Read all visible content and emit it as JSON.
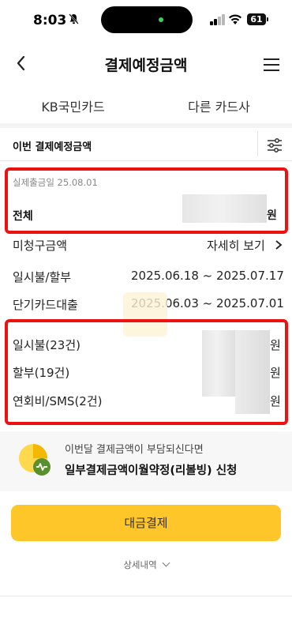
{
  "status_bar": {
    "time": "8:03",
    "battery": "61"
  },
  "header": {
    "title": "결제예정금액"
  },
  "tabs": [
    {
      "label": "KB국민카드"
    },
    {
      "label": "다른 카드사"
    }
  ],
  "section": {
    "title": "이번 결제예정금액",
    "payment_date": "실제출금일 25.08.01",
    "total_label": "전체",
    "total_unit": "원"
  },
  "details": {
    "unbilled_label": "미청구금액",
    "unbilled_link": "자세히 보기",
    "installment_label": "일시불/할부",
    "installment_period": "2025.06.18 ~ 2025.07.17",
    "loan_label": "단기카드대출",
    "loan_period": "2025.06.03 ~ 2025.07.01"
  },
  "breakdown": [
    {
      "label": "일시불(23건)",
      "unit": "원"
    },
    {
      "label": "할부(19건)",
      "unit": "원"
    },
    {
      "label": "연회비/SMS(2건)",
      "unit": "원"
    }
  ],
  "promo": {
    "subtitle": "이번달 결제금액이 부담되신다면",
    "title": "일부결제금액이월약정(리볼빙) 신청"
  },
  "pay_button": "대금결제",
  "detail_toggle": "상세내역",
  "colors": {
    "accent": "#ffc629",
    "highlight": "#ee1111"
  }
}
